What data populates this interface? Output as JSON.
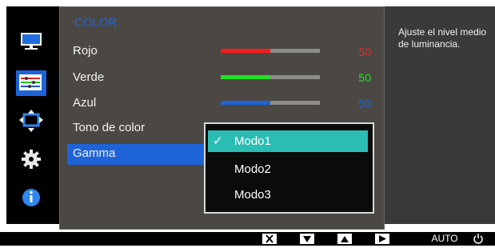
{
  "menu": {
    "title": "COLOR",
    "items": [
      {
        "label": "Rojo",
        "value": "50",
        "fill_fraction": 0.5,
        "color": "#ff1a1a"
      },
      {
        "label": "Verde",
        "value": "50",
        "fill_fraction": 0.5,
        "color": "#22e022"
      },
      {
        "label": "Azul",
        "value": "50",
        "fill_fraction": 0.5,
        "color": "#1e63d8"
      },
      {
        "label": "Tono de color"
      },
      {
        "label": "Gamma",
        "selected": true
      }
    ]
  },
  "dropdown": {
    "options": [
      {
        "label": "Modo1",
        "checked": true,
        "check": "✓"
      },
      {
        "label": "Modo2"
      },
      {
        "label": "Modo3"
      }
    ]
  },
  "help": {
    "text": "Ajuste el nivel medio de luminancia."
  },
  "sidebar": {
    "icons": [
      "monitor-icon",
      "color-settings-icon",
      "size-position-icon",
      "gear-icon",
      "info-icon"
    ],
    "active_index": 1
  },
  "bottom_bar": {
    "buttons": [
      {
        "icon": "close-icon"
      },
      {
        "icon": "down-arrow-icon"
      },
      {
        "icon": "up-arrow-icon"
      },
      {
        "icon": "right-arrow-icon"
      },
      {
        "label": "AUTO"
      },
      {
        "icon": "power-icon"
      }
    ]
  },
  "colors": {
    "accent": "#1e63d8",
    "highlight": "#2bbdb3",
    "panel": "#4b4844",
    "background": "#3a3a3a"
  }
}
